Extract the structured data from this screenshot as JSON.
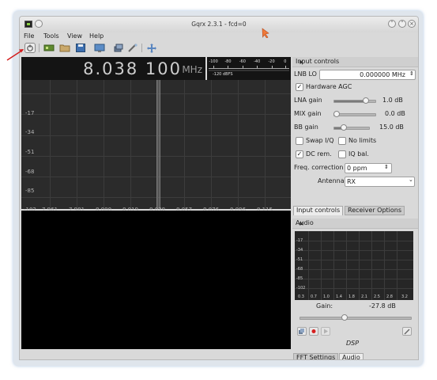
{
  "window": {
    "title": "Gqrx 2.3.1 - fcd=0"
  },
  "menu": [
    "File",
    "Tools",
    "View",
    "Help"
  ],
  "toolbar_icons": [
    "power-icon",
    "hardware-icon",
    "open-icon",
    "save-icon",
    "screen-icon",
    "stack-icon",
    "tools-icon",
    "remote-icon"
  ],
  "frequency": {
    "digits": "8.038 100",
    "unit": "MHz"
  },
  "meter": {
    "scale": [
      "-100",
      "-80",
      "-60",
      "-40",
      "-20",
      "0"
    ],
    "reading": "-120 dBFS"
  },
  "spectrum": {
    "y_labels": [
      "-17",
      "-34",
      "-51",
      "-68",
      "-85",
      "-102"
    ],
    "x_labels": [
      "7.961",
      "7.981",
      "8.000",
      "8.019",
      "8.038",
      "8.057",
      "8.076",
      "8.096",
      "8.115"
    ]
  },
  "input_controls": {
    "title": "Input controls",
    "lnb_label": "LNB LO",
    "lnb_value": "0.000000 MHz",
    "hw_agc_label": "Hardware AGC",
    "hw_agc_checked": true,
    "lna_label": "LNA gain",
    "lna_value": "1.0 dB",
    "mix_label": "MIX gain",
    "mix_value": "0.0 dB",
    "bb_label": "BB gain",
    "bb_value": "15.0 dB",
    "swap_label": "Swap I/Q",
    "nolimits_label": "No limits",
    "dcrem_label": "DC rem.",
    "dcrem_checked": true,
    "iqbal_label": "IQ bal.",
    "freqcorr_label": "Freq. correction",
    "freqcorr_value": "0 ppm",
    "antenna_label": "Antenna",
    "antenna_value": "RX",
    "float_icon": "⋄",
    "close_icon": "×"
  },
  "tabs_top": [
    "Input controls",
    "Receiver Options"
  ],
  "audio": {
    "title": "Audio",
    "y_labels": [
      "-17",
      "-34",
      "-51",
      "-68",
      "-85",
      "-102"
    ],
    "x_labels": [
      "0.3",
      "0.7",
      "1.0",
      "1.4",
      "1.8",
      "2.1",
      "2.5",
      "2.8",
      "3.2"
    ],
    "gain_label": "Gain:",
    "gain_value": "-27.8 dB",
    "dsp_label": "DSP"
  },
  "tabs_bottom": [
    "FFT Settings",
    "Audio"
  ],
  "colors": {
    "plot_bg": "#2b2b2b",
    "record_red": "#d62020"
  }
}
